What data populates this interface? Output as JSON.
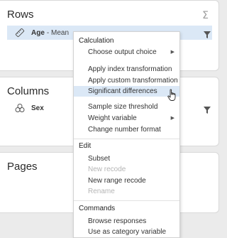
{
  "rows": {
    "title": "Rows",
    "sigma": "Σ",
    "variable": {
      "name": "Age",
      "stat": "- Mean",
      "icon": "ruler-icon"
    }
  },
  "columns": {
    "title": "Columns",
    "variable": {
      "name": "Sex",
      "icon": "categories-icon"
    }
  },
  "pages": {
    "title": "Pages"
  },
  "menu": {
    "calculation_header": "Calculation",
    "choose_output_choice": "Choose output choice",
    "apply_index_transformation": "Apply index transformation",
    "apply_custom_transformation": "Apply custom transformation",
    "significant_differences": "Significant differences",
    "sample_size_threshold": "Sample size threshold",
    "weight_variable": "Weight variable",
    "change_number_format": "Change number format",
    "edit_header": "Edit",
    "subset": "Subset",
    "new_recode": "New recode",
    "new_range_recode": "New range recode",
    "rename": "Rename",
    "commands_header": "Commands",
    "browse_responses": "Browse responses",
    "use_as_category_variable": "Use as category variable",
    "submenu_arrow": "▶"
  },
  "colors": {
    "highlight": "#dbe8f6",
    "disabled_text": "#b5b5b5",
    "background": "#ebebeb"
  }
}
